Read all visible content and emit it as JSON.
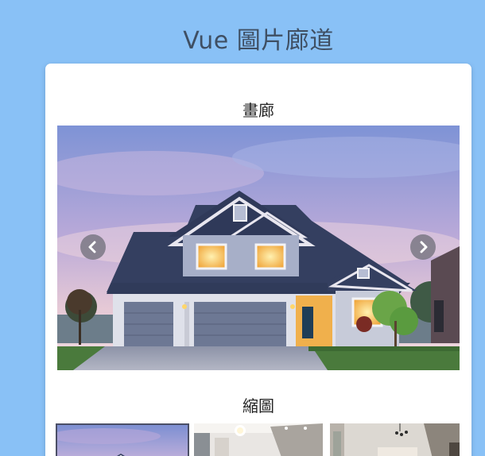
{
  "app": {
    "title": "Vue 圖片廊道"
  },
  "gallery": {
    "title": "畫廊",
    "photo_alt": "house-at-dusk",
    "prev_icon": "chevron-left-icon",
    "next_icon": "chevron-right-icon"
  },
  "thumbnails": {
    "title": "縮圖",
    "items": [
      {
        "alt": "house-exterior",
        "selected": true
      },
      {
        "alt": "kitchen-interior",
        "selected": false
      },
      {
        "alt": "living-room-interior",
        "selected": false
      }
    ]
  },
  "colors": {
    "background": "#89c1f6",
    "card": "#ffffff",
    "title_text": "#3f4f63",
    "selected_border": "#4b4f66"
  }
}
